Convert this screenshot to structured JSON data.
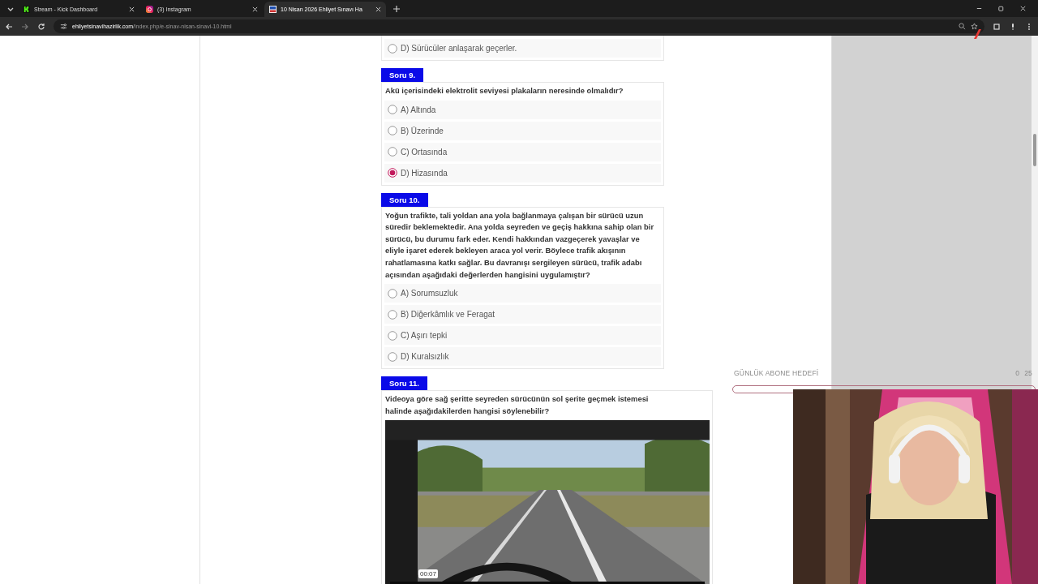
{
  "browser": {
    "tabs": [
      {
        "title": "Stream - Kick Dashboard",
        "kind": "kick",
        "selected": false
      },
      {
        "title": "(3) Instagram",
        "kind": "instagram",
        "selected": false
      },
      {
        "title": "10 Nisan 2026 Ehliyet Sınavı Ha",
        "kind": "site",
        "selected": true
      }
    ],
    "url": {
      "domain": "ehliyetsinavihazirlik.com",
      "path": "/index.php/e-sinav-nisan-sinavi-10.html"
    }
  },
  "questions": [
    {
      "options": [
        {
          "text": "D) Sürücüler anlaşarak geçerler.",
          "selected": false
        }
      ]
    },
    {
      "label": "Soru 9.",
      "text": "Akü içerisindeki elektrolit seviyesi plakaların neresinde olmalıdır?",
      "options": [
        {
          "text": "A) Altında",
          "selected": false
        },
        {
          "text": "B) Üzerinde",
          "selected": false
        },
        {
          "text": "C) Ortasında",
          "selected": false
        },
        {
          "text": "D) Hizasında",
          "selected": true
        }
      ]
    },
    {
      "label": "Soru 10.",
      "text": "Yoğun trafikte, tali yoldan ana yola bağlanmaya çalışan bir sürücü uzun süredir beklemektedir. Ana yolda seyreden ve geçiş hakkına sahip olan bir sürücü, bu durumu fark eder. Kendi hakkından vazgeçerek yavaşlar ve eliyle işaret ederek bekleyen araca yol verir. Böylece trafik akışının rahatlamasına katkı sağlar. Bu davranışı sergileyen sürücü, trafik adabı açısından aşağıdaki değerlerden hangisini uygulamıştır?",
      "options": [
        {
          "text": "A) Sorumsuzluk",
          "selected": false
        },
        {
          "text": "B) Diğerkâmlık ve Feragat",
          "selected": false
        },
        {
          "text": "C) Aşırı tepki",
          "selected": false
        },
        {
          "text": "D) Kuralsızlık",
          "selected": false
        }
      ]
    },
    {
      "label": "Soru 11.",
      "text": "Videoya göre sağ şeritte seyreden sürücünün sol şerite geçmek istemesi halinde aşağıdakilerden hangisi söylenebilir?",
      "video": {
        "kind": "picture",
        "time": "00:07"
      }
    }
  ],
  "overlay": {
    "goal_title": "GÜNLÜK ABONE HEDEFİ",
    "current": "0",
    "target": "25",
    "level": 0
  }
}
